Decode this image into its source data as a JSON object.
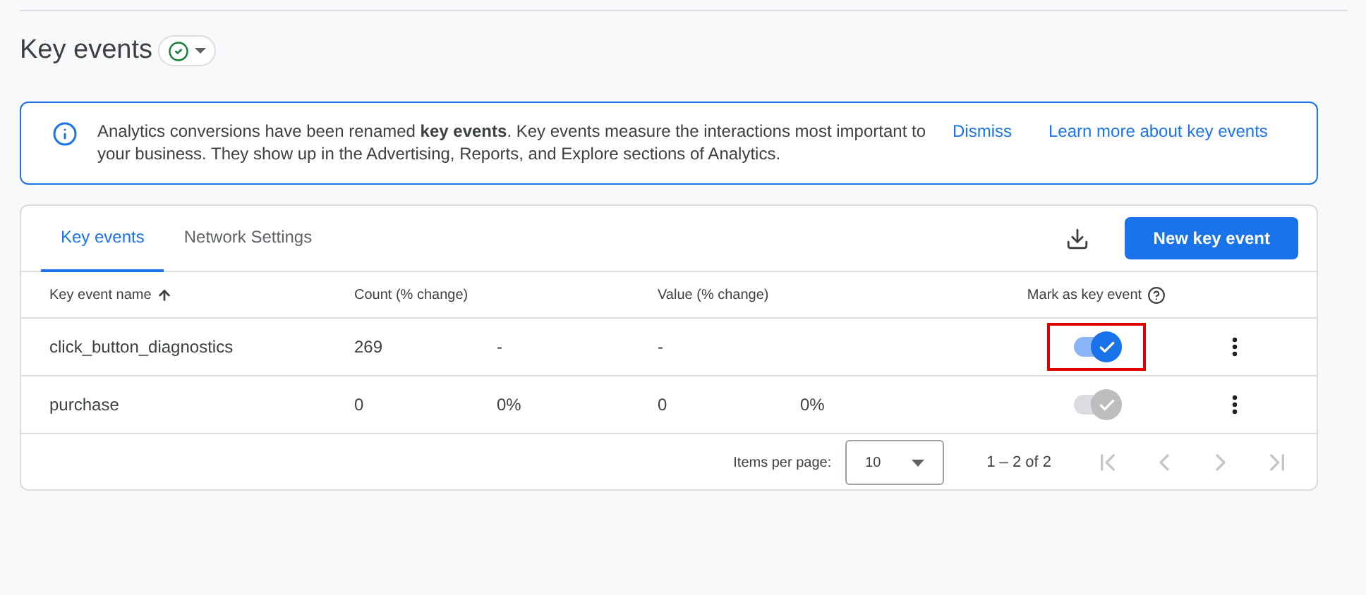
{
  "page_title": "Key events",
  "banner": {
    "text": "Analytics conversions have been renamed **key events**. Key events measure the interactions most important to your business. They show up in the Advertising, Reports, and Explore sections of Analytics.",
    "actions": [
      "Dismiss",
      "Learn more about key events"
    ]
  },
  "tabs": [
    {
      "label": "Key events",
      "selected": true
    },
    {
      "label": "Network Settings",
      "selected": false
    }
  ],
  "new_button": "New key event",
  "table": {
    "columns": [
      "Key event name",
      "Count (% change)",
      "Value (% change)",
      "Mark as key event"
    ],
    "rows": [
      {
        "name": "click_button_diagnostics",
        "count": "269",
        "count_change": "-",
        "value": "-",
        "value_change": "",
        "on": true,
        "disabled": false,
        "highlighted": true
      },
      {
        "name": "purchase",
        "count": "0",
        "count_change": "0%",
        "value": "0",
        "value_change": "0%",
        "on": true,
        "disabled": true,
        "highlighted": false
      }
    ]
  },
  "pagination": {
    "items_label": "Items per page:",
    "per_page": "10",
    "range": "1 – 2 of 2"
  }
}
